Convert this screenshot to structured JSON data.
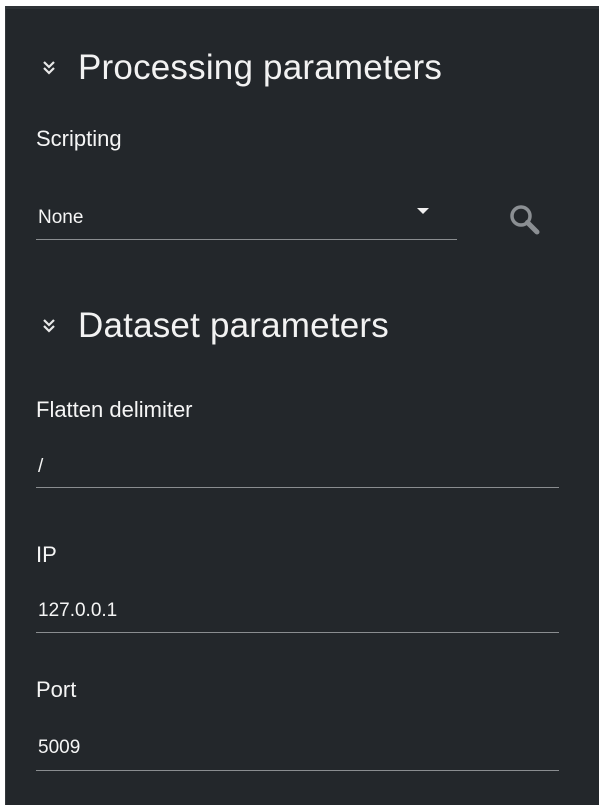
{
  "processing": {
    "title": "Processing parameters",
    "scripting_label": "Scripting",
    "scripting_value": "None"
  },
  "dataset": {
    "title": "Dataset parameters",
    "flatten_label": "Flatten delimiter",
    "flatten_value": "/",
    "ip_label": "IP",
    "ip_value": "127.0.0.1",
    "port_label": "Port",
    "port_value": "5009"
  },
  "icons": {
    "section_toggle": "double-chevron-down-icon",
    "search": "search-icon",
    "dropdown": "caret-down-icon"
  },
  "colors": {
    "panel_bg": "#23272b",
    "text": "#f5f5f5",
    "underline": "#8a8d90",
    "icon_gray": "#8b8f93"
  }
}
